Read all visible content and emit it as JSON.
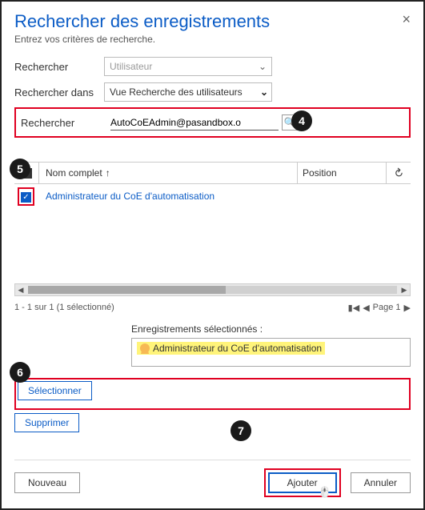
{
  "dialog": {
    "title": "Rechercher des enregistrements",
    "subtitle": "Entrez vos critères de recherche."
  },
  "form": {
    "lookFor_label": "Rechercher",
    "lookFor_placeholder": "Utilisateur",
    "lookIn_label": "Rechercher dans",
    "lookIn_value": "Vue Recherche des utilisateurs",
    "search_label": "Rechercher",
    "search_value": "AutoCoEAdmin@pasandbox.o"
  },
  "grid": {
    "columns": {
      "name": "Nom complet",
      "position": "Position"
    },
    "rows": [
      {
        "checked": true,
        "name": "Administrateur du CoE d'automatisation",
        "position": ""
      }
    ]
  },
  "pager": {
    "summary": "1 - 1 sur 1 (1 sélectionné)",
    "page_label": "Page 1"
  },
  "selected": {
    "label": "Enregistrements sélectionnés :",
    "items": [
      "Administrateur du CoE d'automatisation"
    ]
  },
  "actions": {
    "select": "Sélectionner",
    "remove": "Supprimer",
    "new": "Nouveau",
    "add": "Ajouter",
    "cancel": "Annuler"
  },
  "callouts": {
    "c4": "4",
    "c5": "5",
    "c6": "6",
    "c7": "7"
  }
}
